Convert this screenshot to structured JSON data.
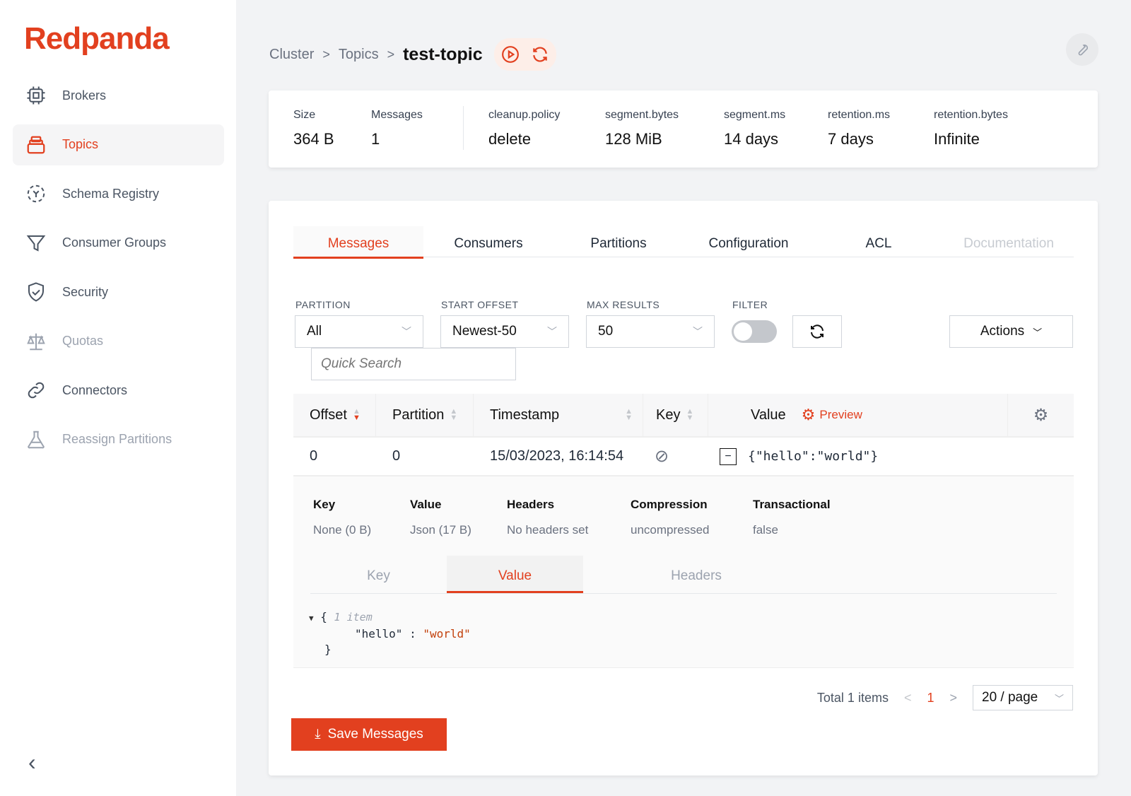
{
  "brand": {
    "logo": "Redpanda",
    "accent": "#e2401f"
  },
  "sidebar": {
    "items": [
      {
        "label": "Brokers",
        "icon": "cpu-icon",
        "state": "normal"
      },
      {
        "label": "Topics",
        "icon": "topics-icon",
        "state": "active"
      },
      {
        "label": "Schema Registry",
        "icon": "schema-icon",
        "state": "normal"
      },
      {
        "label": "Consumer Groups",
        "icon": "funnel-icon",
        "state": "normal"
      },
      {
        "label": "Security",
        "icon": "shield-icon",
        "state": "normal"
      },
      {
        "label": "Quotas",
        "icon": "scale-icon",
        "state": "disabled"
      },
      {
        "label": "Connectors",
        "icon": "link-icon",
        "state": "normal"
      },
      {
        "label": "Reassign Partitions",
        "icon": "flask-icon",
        "state": "disabled"
      }
    ],
    "collapse": "‹"
  },
  "breadcrumb": {
    "items": [
      "Cluster",
      "Topics"
    ],
    "current": "test-topic",
    "sep": ">"
  },
  "stats": [
    {
      "label": "Size",
      "value": "364 B"
    },
    {
      "label": "Messages",
      "value": "1"
    },
    {
      "label": "cleanup.policy",
      "value": "delete"
    },
    {
      "label": "segment.bytes",
      "value": "128 MiB"
    },
    {
      "label": "segment.ms",
      "value": "14 days"
    },
    {
      "label": "retention.ms",
      "value": "7 days"
    },
    {
      "label": "retention.bytes",
      "value": "Infinite"
    }
  ],
  "tabs": [
    "Messages",
    "Consumers",
    "Partitions",
    "Configuration",
    "ACL",
    "Documentation"
  ],
  "filters": {
    "partition_label": "PARTITION",
    "partition": "All",
    "offset_label": "START OFFSET",
    "offset": "Newest-50",
    "max_label": "MAX RESULTS",
    "max": "50",
    "filter_label": "FILTER",
    "filter_on": false,
    "actions": "Actions",
    "search_placeholder": "Quick Search"
  },
  "table": {
    "columns": [
      "Offset",
      "Partition",
      "Timestamp",
      "Key",
      "Value"
    ],
    "preview": "Preview",
    "rows": [
      {
        "offset": "0",
        "partition": "0",
        "timestamp": "15/03/2023, 16:14:54",
        "value": "{\"hello\":\"world\"}"
      }
    ]
  },
  "details": {
    "meta": [
      {
        "label": "Key",
        "value": "None (0 B)"
      },
      {
        "label": "Value",
        "value": "Json (17 B)"
      },
      {
        "label": "Headers",
        "value": "No headers set"
      },
      {
        "label": "Compression",
        "value": "uncompressed"
      },
      {
        "label": "Transactional",
        "value": "false"
      }
    ],
    "tabs": [
      "Key",
      "Value",
      "Headers"
    ],
    "json": {
      "open": "{",
      "count": "1 item",
      "key": "\"hello\"",
      "colon": " : ",
      "val": "\"world\"",
      "close": "}"
    }
  },
  "pagination": {
    "total": "Total 1 items",
    "page": "1",
    "per_page": "20 / page"
  },
  "save_label": "Save Messages"
}
